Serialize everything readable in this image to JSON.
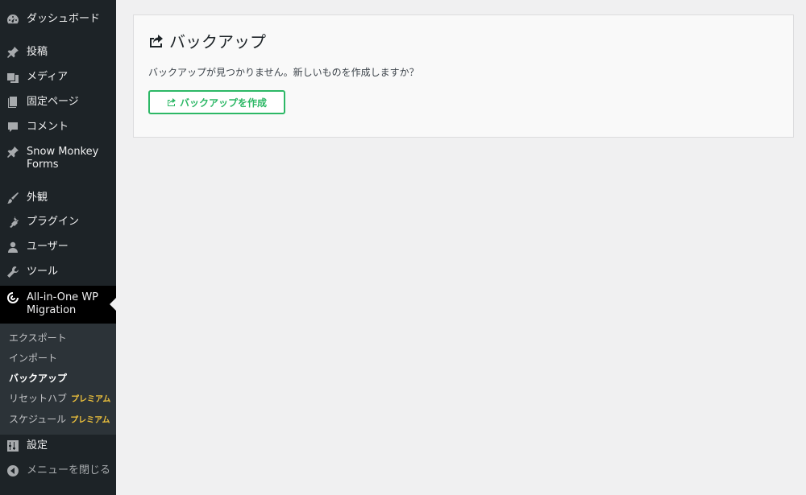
{
  "sidebar": {
    "items": [
      {
        "label": "ダッシュボード",
        "icon": "dashboard-icon"
      },
      {
        "label": "投稿",
        "icon": "pin-icon"
      },
      {
        "label": "メディア",
        "icon": "media-icon"
      },
      {
        "label": "固定ページ",
        "icon": "page-icon"
      },
      {
        "label": "コメント",
        "icon": "comment-icon"
      },
      {
        "label": "Snow Monkey Forms",
        "icon": "pin-icon"
      },
      {
        "label": "外観",
        "icon": "brush-icon"
      },
      {
        "label": "プラグイン",
        "icon": "plugin-icon"
      },
      {
        "label": "ユーザー",
        "icon": "user-icon"
      },
      {
        "label": "ツール",
        "icon": "wrench-icon"
      },
      {
        "label": "All-in-One WP Migration",
        "icon": "migration-icon"
      },
      {
        "label": "設定",
        "icon": "settings-icon"
      },
      {
        "label": "メニューを閉じる",
        "icon": "collapse-icon"
      }
    ],
    "submenu": [
      {
        "label": "エクスポート"
      },
      {
        "label": "インポート"
      },
      {
        "label": "バックアップ"
      },
      {
        "label": "リセットハブ",
        "badge": "プレミアム"
      },
      {
        "label": "スケジュール",
        "badge": "プレミアム"
      }
    ]
  },
  "main": {
    "title": "バックアップ",
    "message": "バックアップが見つかりません。新しいものを作成しますか？",
    "create_button": "バックアップを作成"
  },
  "colors": {
    "sidebar_bg": "#1d2327",
    "submenu_bg": "#2c3338",
    "accent_green": "#2db866",
    "premium_yellow": "#f0c33c"
  }
}
